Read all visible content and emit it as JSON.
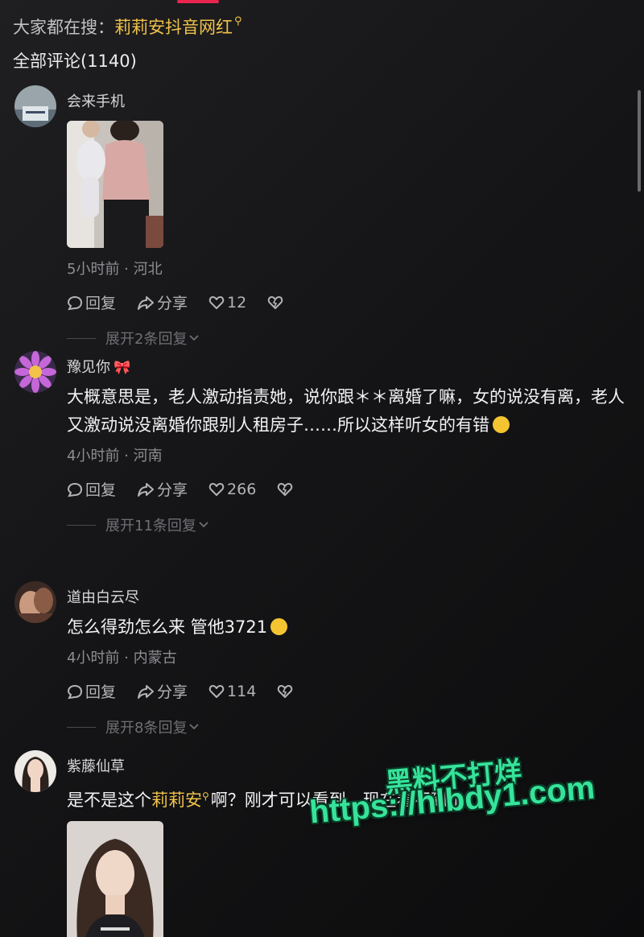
{
  "search": {
    "prefix": "大家都在搜：",
    "keyword": "莉莉安抖音网红"
  },
  "comments_total": "全部评论(1140)",
  "comments": [
    {
      "username": "会来手机",
      "text": "",
      "meta": "5小时前 · 河北",
      "reply": "回复",
      "share": "分享",
      "likes": "12",
      "expand": "展开2条回复"
    },
    {
      "username": "豫见你",
      "text": "大概意思是，老人激动指责她，说你跟＊＊离婚了嘛，女的说没有离，老人又激动说没离婚你跟别人租房子……所以这样听女的有错",
      "meta": "4小时前 · 河南",
      "reply": "回复",
      "share": "分享",
      "likes": "266",
      "expand": "展开11条回复"
    },
    {
      "username": "道由白云尽",
      "text": "怎么得劲怎么来 管他3721",
      "meta": "4小时前 · 内蒙古",
      "reply": "回复",
      "share": "分享",
      "likes": "114",
      "expand": "展开8条回复"
    },
    {
      "username": "紫藤仙草",
      "text_before": "是不是这个",
      "keyword": "莉莉安",
      "text_after": "啊？刚才可以看到，现在看不到了"
    }
  ],
  "watermark": {
    "title": "黑料不打烊",
    "url": "https://hlbdy1.com"
  },
  "colors": {
    "keyword": "#f1c24a",
    "accent": "#e8244f",
    "watermark": "#36e39a"
  },
  "icons": [
    "search-icon",
    "reply-icon",
    "share-icon",
    "heart-icon",
    "dislike-icon",
    "chevron-down-icon",
    "ribbon-icon",
    "emoji-icon"
  ]
}
